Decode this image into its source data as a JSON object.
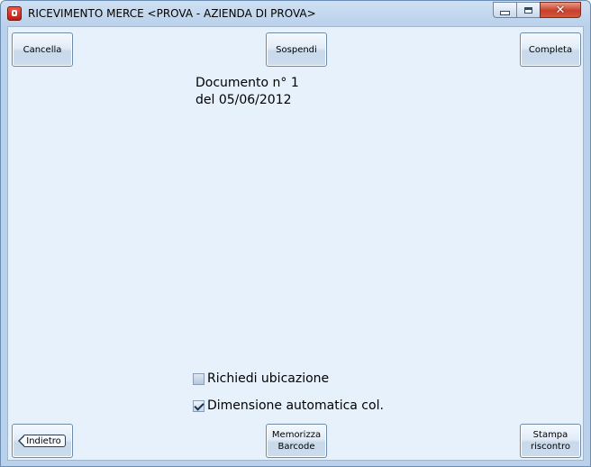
{
  "window": {
    "title": "RICEVIMENTO MERCE <PROVA - AZIENDA DI PROVA>",
    "controls": {
      "minimize": "minimize",
      "maximize": "maximize",
      "close": "close"
    }
  },
  "toolbar": {
    "cancel_label": "Cancella",
    "suspend_label": "Sospendi",
    "complete_label": "Completa"
  },
  "document": {
    "number_line": "Documento n° 1",
    "date_line": "del 05/06/2012"
  },
  "options": {
    "request_location": {
      "label": "Richiedi ubicazione",
      "checked": false
    },
    "auto_col_size": {
      "label": "Dimensione automatica col.",
      "checked": true
    }
  },
  "footer": {
    "back_label": "Indietro",
    "save_barcode_label": "Memorizza\nBarcode",
    "print_check_label": "Stampa\nriscontro"
  },
  "colors": {
    "window_frame": "#b9d1ea",
    "client_background": "#e6f1fb",
    "close_button": "#c7402a"
  }
}
